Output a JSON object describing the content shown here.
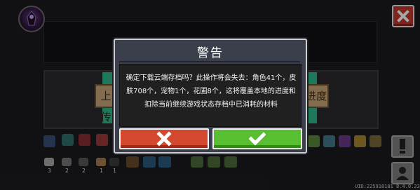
{
  "header": {
    "avatar_name": "player-avatar",
    "close_icon": "close-icon"
  },
  "background": {
    "upload_label": "上传",
    "download_label": "进度"
  },
  "inventory": {
    "counts": [
      "3",
      "2",
      "2",
      "1",
      "1"
    ]
  },
  "uid_text": "UID:225918181 8.4.0.23",
  "dialog": {
    "title": "警告",
    "message": "确定下载云端存档吗？此操作将会失去：角色41个，皮肤708个，宠物1个，花圃8个，这将覆盖本地的进度和扣除当前继续游戏状态存档中已消耗的材料",
    "cancel_icon": "x-icon",
    "confirm_icon": "checkmark-icon"
  },
  "colors": {
    "dialog_bg": "#3a3f4b",
    "cancel": "#d2492f",
    "confirm": "#59bf32",
    "close": "#c0392b"
  }
}
